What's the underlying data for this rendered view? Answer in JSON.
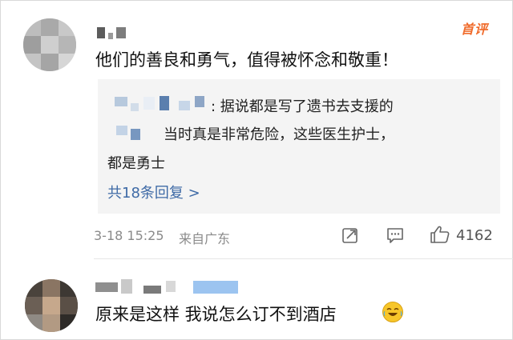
{
  "comments": [
    {
      "badge": "首评",
      "text": "他们的善良和勇气，值得被怀念和敬重！",
      "replies": {
        "line1": ": 据说都是写了遗书去支援的",
        "line2": "当时真是非常危险，这些医生护士，",
        "line3": "都是勇士",
        "more_label": "共18条回复 >"
      },
      "meta": {
        "time": "3-18 15:25",
        "location": "来自广东",
        "likes": "4162"
      },
      "icons": [
        "share-icon",
        "comment-icon",
        "like-icon"
      ]
    },
    {
      "text": "原来是这样 我说怎么订不到酒店",
      "emoji": "laughing-crying-emoji"
    }
  ],
  "colors": {
    "accent_link": "#3e6aa6",
    "badge": "#f06b2b",
    "meta_text": "#8a8a8a",
    "reply_bg": "#f4f4f4"
  }
}
